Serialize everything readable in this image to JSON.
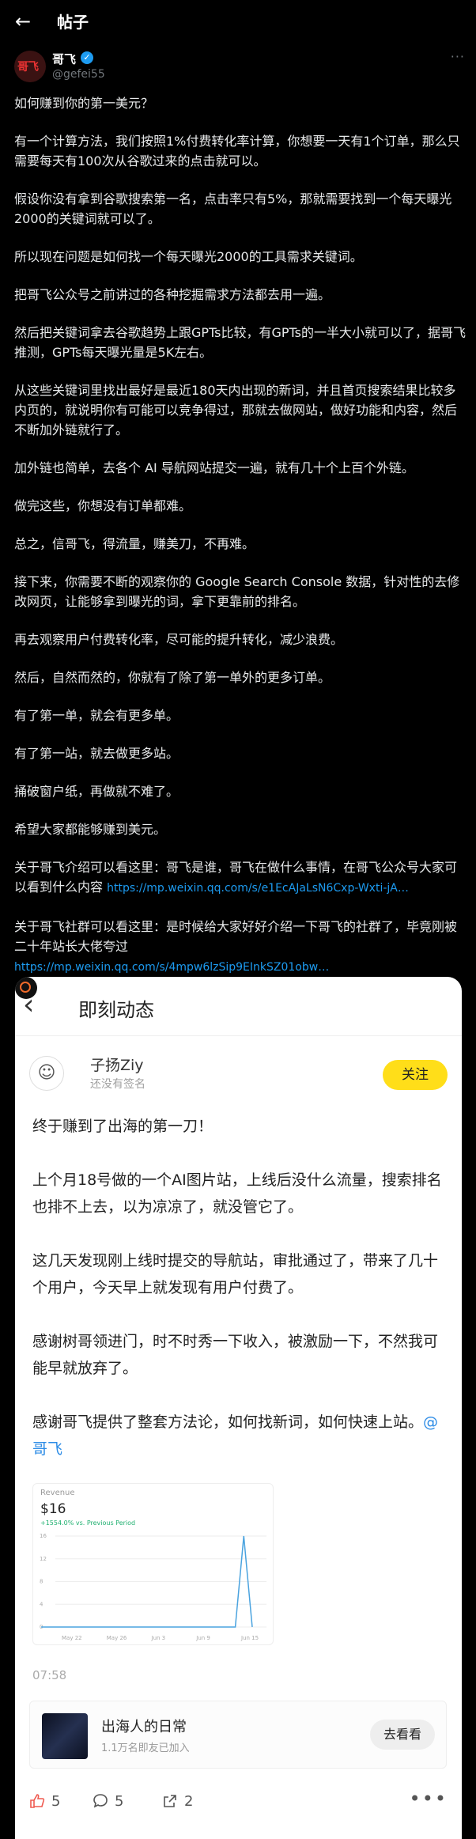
{
  "header": {
    "title": "帖子",
    "back_icon": "arrow-left-icon"
  },
  "author": {
    "avatar_text": "哥飞",
    "name": "哥飞",
    "handle": "@gefei55",
    "verified_icon": "verified-check-icon",
    "more_icon": "more-horizontal-icon"
  },
  "post": {
    "paragraphs": [
      "如何赚到你的第一美元？",
      "有一个计算方法，我们按照1%付费转化率计算，你想要一天有1个订单，那么只需要每天有100次从谷歌过来的点击就可以。",
      "假设你没有拿到谷歌搜索第一名，点击率只有5%，那就需要找到一个每天曝光2000的关键词就可以了。",
      "所以现在问题是如何找一个每天曝光2000的工具需求关键词。",
      "把哥飞公众号之前讲过的各种挖掘需求方法都去用一遍。",
      "然后把关键词拿去谷歌趋势上跟GPTs比较，有GPTs的一半大小就可以了，据哥飞推测，GPTs每天曝光量是5K左右。",
      "从这些关键词里找出最好是最近180天内出现的新词，并且首页搜索结果比较多内页的，就说明你有可能可以竞争得过，那就去做网站，做好功能和内容，然后不断加外链就行了。",
      "加外链也简单，去各个 AI 导航网站提交一遍，就有几十个上百个外链。",
      "做完这些，你想没有订单都难。",
      "总之，信哥飞，得流量，赚美刀，不再难。",
      "接下来，你需要不断的观察你的 Google Search Console 数据，针对性的去修改网页，让能够拿到曝光的词，拿下更靠前的排名。",
      "再去观察用户付费转化率，尽可能的提升转化，减少浪费。",
      "然后，自然而然的，你就有了除了第一单外的更多订单。",
      "有了第一单，就会有更多单。",
      "有了第一站，就去做更多站。",
      "捅破窗户纸，再做就不难了。",
      "希望大家都能够赚到美元。"
    ],
    "intro_text": "关于哥飞介绍可以看这里：哥飞是谁，哥飞在做什么事情，在哥飞公众号大家可以看到什么内容",
    "intro_link": "https://mp.weixin.qq.com/s/e1EcAJaLsN6Cxp-Wxti-jA…",
    "community_text": "关于哥飞社群可以看这里：是时候给大家好好介绍一下哥飞的社群了，毕竟刚被二十年站长大佬夸过",
    "community_link": "https://mp.weixin.qq.com/s/4mpw6lzSip9EInkSZ01obw…"
  },
  "card": {
    "title": "即刻动态",
    "back_icon": "chevron-left-icon",
    "user_name": "子扬Ziy",
    "user_signature": "还没有签名",
    "follow_label": "关注",
    "paragraphs": [
      "终于赚到了出海的第一刀！",
      "上个月18号做的一个AI图片站，上线后没什么流量，搜索排名也排不上去，以为凉凉了，就没管它了。",
      "这几天发现刚上线时提交的导航站，审批通过了，带来了几十个用户，今天早上就发现有用户付费了。",
      "感谢树哥领进门，时不时秀一下收入，被激励一下，不然我可能早就放弃了。"
    ],
    "last_paragraph": "感谢哥飞提供了整套方法论，如何找新词，如何快速上站。",
    "mention": "@哥飞",
    "time": "07:58",
    "circle_name": "出海人的日常",
    "circle_sub": "1.1万名即友已加入",
    "visit_label": "去看看",
    "likes": "5",
    "comments": "5",
    "shares": "2"
  },
  "chart_data": {
    "type": "line",
    "title": "Revenue",
    "value": "$16",
    "change": "+1554.0% vs. Previous Period",
    "x_ticks": [
      "May 22",
      "May 26",
      "Jun 3",
      "Jun 9",
      "Jun 15"
    ],
    "y_ticks": [
      "16",
      "12",
      "8",
      "4",
      "0"
    ],
    "ylim": [
      0,
      16
    ],
    "series": [
      {
        "values": [
          0,
          0,
          0,
          0,
          0,
          0,
          0,
          0,
          0,
          0,
          0,
          0,
          0,
          0,
          0,
          0,
          0,
          0,
          0,
          0,
          0,
          0,
          0,
          0,
          16,
          0
        ]
      }
    ],
    "line_color": "#4aa3df"
  }
}
